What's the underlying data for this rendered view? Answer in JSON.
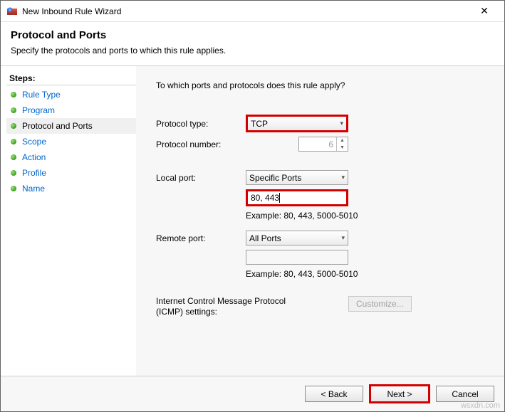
{
  "window": {
    "title": "New Inbound Rule Wizard"
  },
  "header": {
    "title": "Protocol and Ports",
    "subtitle": "Specify the protocols and ports to which this rule applies."
  },
  "sidebar": {
    "title": "Steps:",
    "items": [
      {
        "label": "Rule Type",
        "current": false
      },
      {
        "label": "Program",
        "current": false
      },
      {
        "label": "Protocol and Ports",
        "current": true
      },
      {
        "label": "Scope",
        "current": false
      },
      {
        "label": "Action",
        "current": false
      },
      {
        "label": "Profile",
        "current": false
      },
      {
        "label": "Name",
        "current": false
      }
    ]
  },
  "content": {
    "question": "To which ports and protocols does this rule apply?",
    "protocol_type_label": "Protocol type:",
    "protocol_type_value": "TCP",
    "protocol_number_label": "Protocol number:",
    "protocol_number_value": "6",
    "local_port_label": "Local port:",
    "local_port_select": "Specific Ports",
    "local_port_value": "80, 443",
    "local_port_example": "Example: 80, 443, 5000-5010",
    "remote_port_label": "Remote port:",
    "remote_port_select": "All Ports",
    "remote_port_value": "",
    "remote_port_example": "Example: 80, 443, 5000-5010",
    "icmp_label": "Internet Control Message Protocol (ICMP) settings:",
    "icmp_button": "Customize..."
  },
  "footer": {
    "back": "< Back",
    "next": "Next >",
    "cancel": "Cancel"
  },
  "watermark": "wsxdn.com"
}
